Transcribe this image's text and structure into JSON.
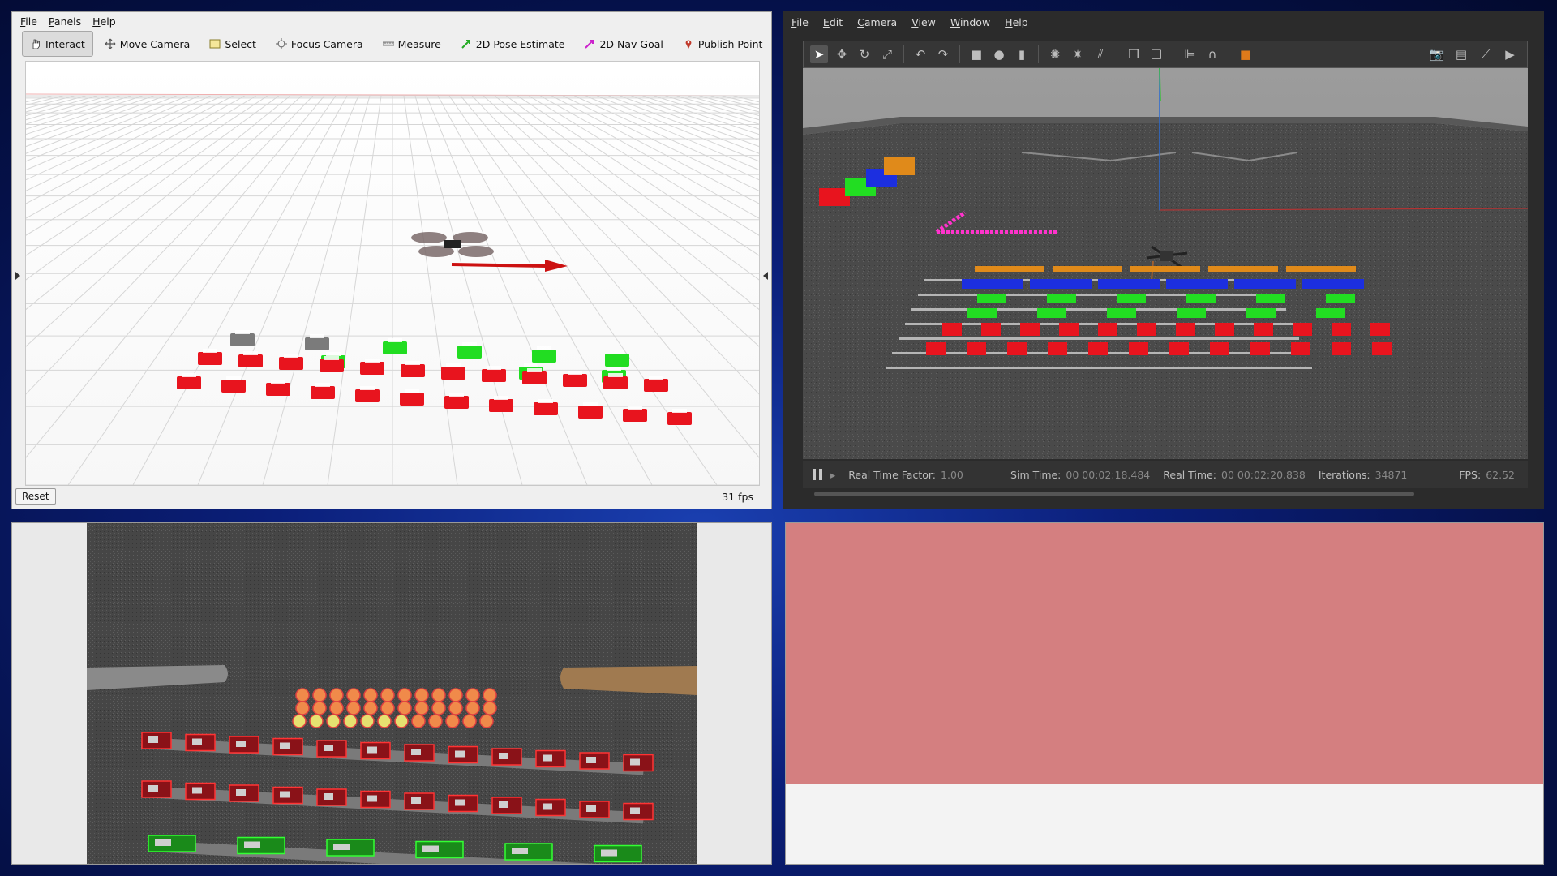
{
  "rviz": {
    "menu": [
      "File",
      "Panels",
      "Help"
    ],
    "tools": [
      {
        "label": "Interact",
        "icon": "hand-icon",
        "active": true
      },
      {
        "label": "Move Camera",
        "icon": "move-camera-icon"
      },
      {
        "label": "Select",
        "icon": "select-box-icon"
      },
      {
        "label": "Focus Camera",
        "icon": "focus-crosshair-icon"
      },
      {
        "label": "Measure",
        "icon": "ruler-icon"
      },
      {
        "label": "2D Pose Estimate",
        "icon": "green-arrow-icon"
      },
      {
        "label": "2D Nav Goal",
        "icon": "pink-arrow-icon"
      },
      {
        "label": "Publish Point",
        "icon": "map-pin-icon"
      }
    ],
    "more_label": "»",
    "reset_label": "Reset",
    "fps": "31 fps"
  },
  "gazebo": {
    "menu": [
      "File",
      "Edit",
      "Camera",
      "View",
      "Window",
      "Help"
    ],
    "status": {
      "real_time_factor_label": "Real Time Factor:",
      "real_time_factor": "1.00",
      "sim_time_label": "Sim Time:",
      "sim_time": "00 00:02:18.484",
      "real_time_label": "Real Time:",
      "real_time": "00 00:02:20.838",
      "iterations_label": "Iterations:",
      "iterations": "34871",
      "fps_label": "FPS:",
      "fps": "62.52"
    }
  },
  "colors": {
    "red_block": "#e8141e",
    "green_block": "#22dd22",
    "gray_block": "#7b7b7b",
    "blue_block": "#1c2fe0",
    "orange_block": "#e08a1a",
    "magenta": "#ff33cc",
    "pink_panel": "#d47f80"
  }
}
